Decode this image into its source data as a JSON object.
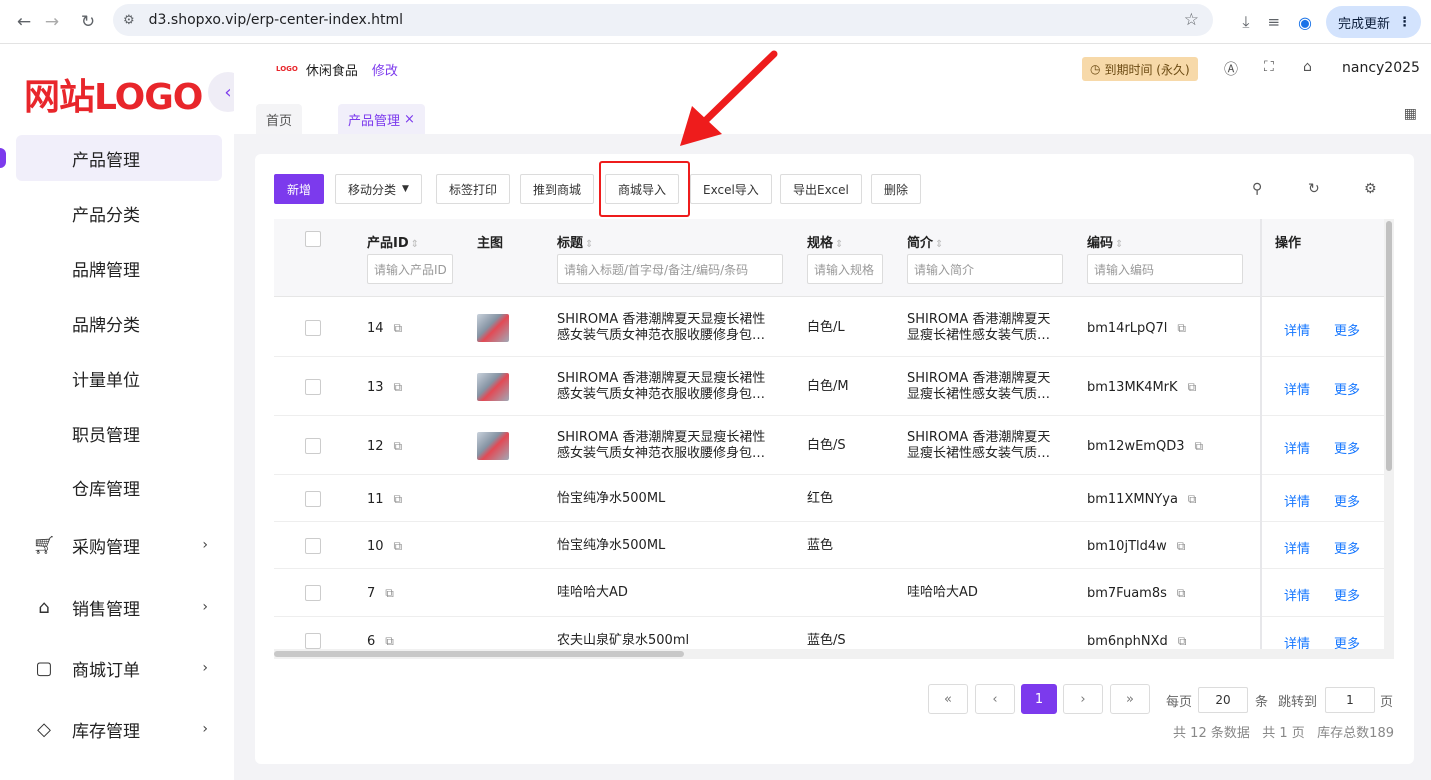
{
  "browser": {
    "url": "d3.shopxo.vip/erp-center-index.html",
    "update_label": "完成更新"
  },
  "sidebar": {
    "logo_text": "网站LOGO",
    "items": [
      {
        "label": "产品管理",
        "icon": "",
        "active": true,
        "sub": true
      },
      {
        "label": "产品分类",
        "icon": "",
        "active": false,
        "sub": true
      },
      {
        "label": "品牌管理",
        "icon": "",
        "active": false,
        "sub": true
      },
      {
        "label": "品牌分类",
        "icon": "",
        "active": false,
        "sub": true
      },
      {
        "label": "计量单位",
        "icon": "",
        "active": false,
        "sub": true
      },
      {
        "label": "职员管理",
        "icon": "",
        "active": false,
        "sub": true
      },
      {
        "label": "仓库管理",
        "icon": "",
        "active": false,
        "sub": true
      },
      {
        "label": "采购管理",
        "icon": "cart-icon",
        "active": false,
        "sub": false
      },
      {
        "label": "销售管理",
        "icon": "tag-icon",
        "active": false,
        "sub": false
      },
      {
        "label": "商城订单",
        "icon": "bag-icon",
        "active": false,
        "sub": false
      },
      {
        "label": "库存管理",
        "icon": "box-icon",
        "active": false,
        "sub": false
      }
    ]
  },
  "header": {
    "shop_logo": "LOGO",
    "shop_name": "休闲食品",
    "edit_label": "修改",
    "expire_label": "到期时间 (永久)",
    "username": "nancy2025"
  },
  "tabs": {
    "home": "首页",
    "active": "产品管理",
    "close": "×"
  },
  "toolbar": {
    "add": "新增",
    "move_category": "移动分类",
    "print_label": "标签打印",
    "push_mall": "推到商城",
    "mall_import": "商城导入",
    "excel_import": "Excel导入",
    "export_excel": "导出Excel",
    "delete": "删除"
  },
  "table": {
    "headers": {
      "id": "产品ID",
      "image": "主图",
      "title": "标题",
      "spec": "规格",
      "intro": "简介",
      "code": "编码",
      "ops": "操作"
    },
    "filters": {
      "id": "请输入产品ID",
      "title": "请输入标题/首字母/备注/编码/条码",
      "spec": "请输入规格",
      "intro": "请输入简介",
      "code": "请输入编码"
    },
    "rows": [
      {
        "id": "14",
        "has_image": true,
        "title_1": "SHIROMA 香港潮牌夏天显瘦长裙性",
        "title_2": "感女装气质女神范衣服收腰修身包…",
        "spec": "白色/L",
        "intro_1": "SHIROMA 香港潮牌夏天",
        "intro_2": "显瘦长裙性感女装气质…",
        "code": "bm14rLpQ7l",
        "detail": "详情",
        "more": "更多"
      },
      {
        "id": "13",
        "has_image": true,
        "title_1": "SHIROMA 香港潮牌夏天显瘦长裙性",
        "title_2": "感女装气质女神范衣服收腰修身包…",
        "spec": "白色/M",
        "intro_1": "SHIROMA 香港潮牌夏天",
        "intro_2": "显瘦长裙性感女装气质…",
        "code": "bm13MK4MrK",
        "detail": "详情",
        "more": "更多"
      },
      {
        "id": "12",
        "has_image": true,
        "title_1": "SHIROMA 香港潮牌夏天显瘦长裙性",
        "title_2": "感女装气质女神范衣服收腰修身包…",
        "spec": "白色/S",
        "intro_1": "SHIROMA 香港潮牌夏天",
        "intro_2": "显瘦长裙性感女装气质…",
        "code": "bm12wEmQD3",
        "detail": "详情",
        "more": "更多"
      },
      {
        "id": "11",
        "has_image": false,
        "title_1": "怡宝纯净水500ML",
        "title_2": "",
        "spec": "红色",
        "intro_1": "",
        "intro_2": "",
        "code": "bm11XMNYya",
        "detail": "详情",
        "more": "更多"
      },
      {
        "id": "10",
        "has_image": false,
        "title_1": "怡宝纯净水500ML",
        "title_2": "",
        "spec": "蓝色",
        "intro_1": "",
        "intro_2": "",
        "code": "bm10jTld4w",
        "detail": "详情",
        "more": "更多"
      },
      {
        "id": "7",
        "has_image": false,
        "title_1": "哇哈哈大AD",
        "title_2": "",
        "spec": "",
        "intro_1": "哇哈哈大AD",
        "intro_2": "",
        "code": "bm7Fuam8s",
        "detail": "详情",
        "more": "更多"
      },
      {
        "id": "6",
        "has_image": false,
        "title_1": "农夫山泉矿泉水500ml",
        "title_2": "",
        "spec": "蓝色/S",
        "intro_1": "",
        "intro_2": "",
        "code": "bm6nphNXd",
        "detail": "详情",
        "more": "更多"
      }
    ]
  },
  "pagination": {
    "first": "«",
    "prev": "‹",
    "current": "1",
    "next": "›",
    "last": "»",
    "per_page_label": "每页",
    "per_page_value": "20",
    "per_page_unit": "条",
    "jump_label": "跳转到",
    "jump_value": "1",
    "jump_unit": "页",
    "summary": "共 12 条数据   共 1 页   库存总数189"
  },
  "colors": {
    "accent": "#7c3aed",
    "link": "#1677ff",
    "logo_red": "#e8262b",
    "annotation_red": "#ee1c1c"
  }
}
